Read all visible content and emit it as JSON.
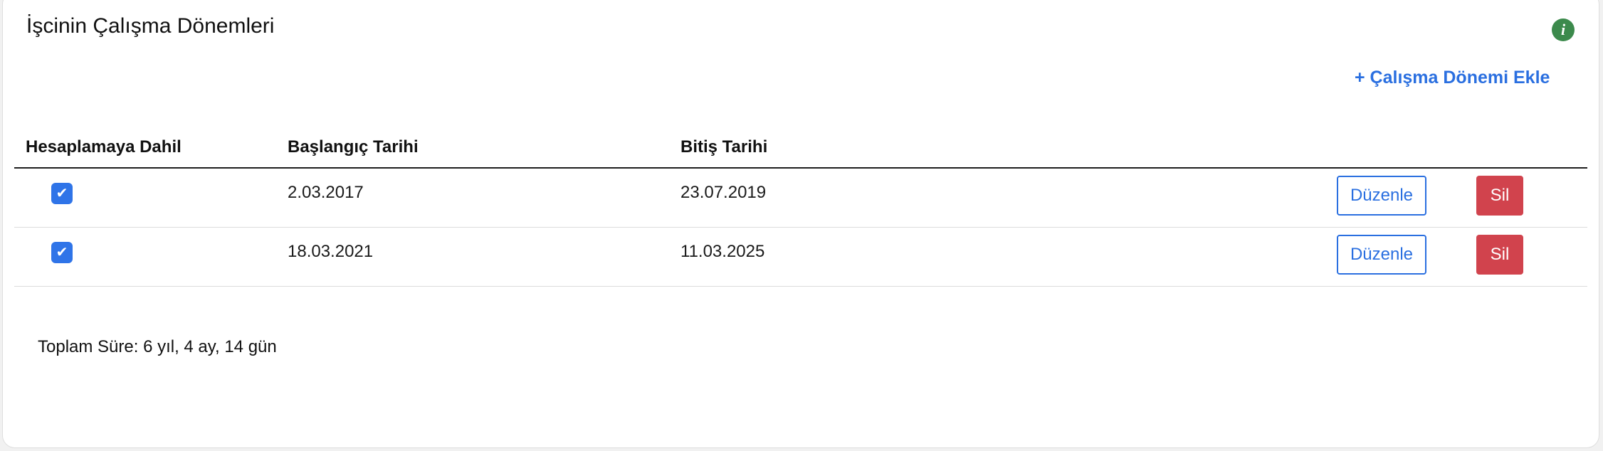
{
  "panel": {
    "title": "İşcinin Çalışma Dönemleri",
    "info_icon": "info-icon",
    "add_link": "+ Çalışma Dönemi Ekle"
  },
  "table": {
    "headers": [
      "Hesaplamaya Dahil",
      "Başlangıç Tarihi",
      "Bitiş Tarihi"
    ],
    "rows": [
      {
        "included": true,
        "start": "2.03.2017",
        "end": "23.07.2019",
        "edit_label": "Düzenle",
        "delete_label": "Sil"
      },
      {
        "included": true,
        "start": "18.03.2021",
        "end": "11.03.2025",
        "edit_label": "Düzenle",
        "delete_label": "Sil"
      }
    ]
  },
  "summary": {
    "total": "Toplam Süre: 6 yıl, 4 ay, 14 gün"
  },
  "colors": {
    "accent": "#2a6fe0",
    "danger": "#d1434d",
    "info": "#3c8a4c",
    "checkbox": "#2f74e8"
  }
}
